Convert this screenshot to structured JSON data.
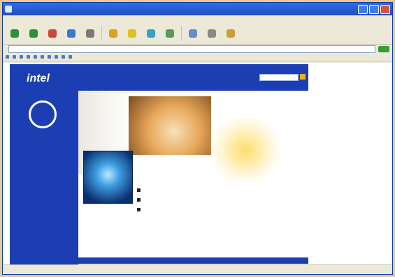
{
  "window": {
    "title": ""
  },
  "menubar": {
    "items": [
      "",
      "",
      "",
      "",
      "",
      ""
    ]
  },
  "toolbar": {
    "buttons": [
      "",
      "",
      "",
      "",
      "",
      "",
      "",
      "",
      "",
      "",
      "",
      ""
    ]
  },
  "addressbar": {
    "label": "",
    "url": "",
    "go_label": ""
  },
  "linksbar": {
    "items": [
      "",
      "",
      "",
      "",
      "",
      "",
      "",
      "",
      "",
      ""
    ]
  },
  "page": {
    "sidebar": {
      "logo": "intel",
      "badge": "",
      "text": ""
    },
    "header": {
      "breadcrumb": "",
      "top_links": "",
      "nav": [
        "",
        "",
        "",
        "",
        ""
      ]
    },
    "content": {
      "intro": "",
      "options": [
        "",
        "",
        ""
      ]
    }
  },
  "statusbar": {
    "left": "",
    "right": ""
  },
  "colors": {
    "titlebar": "#2e6de4",
    "sidebar_blue": "#1b3fb3",
    "accent_gold": "#f2b01e"
  }
}
